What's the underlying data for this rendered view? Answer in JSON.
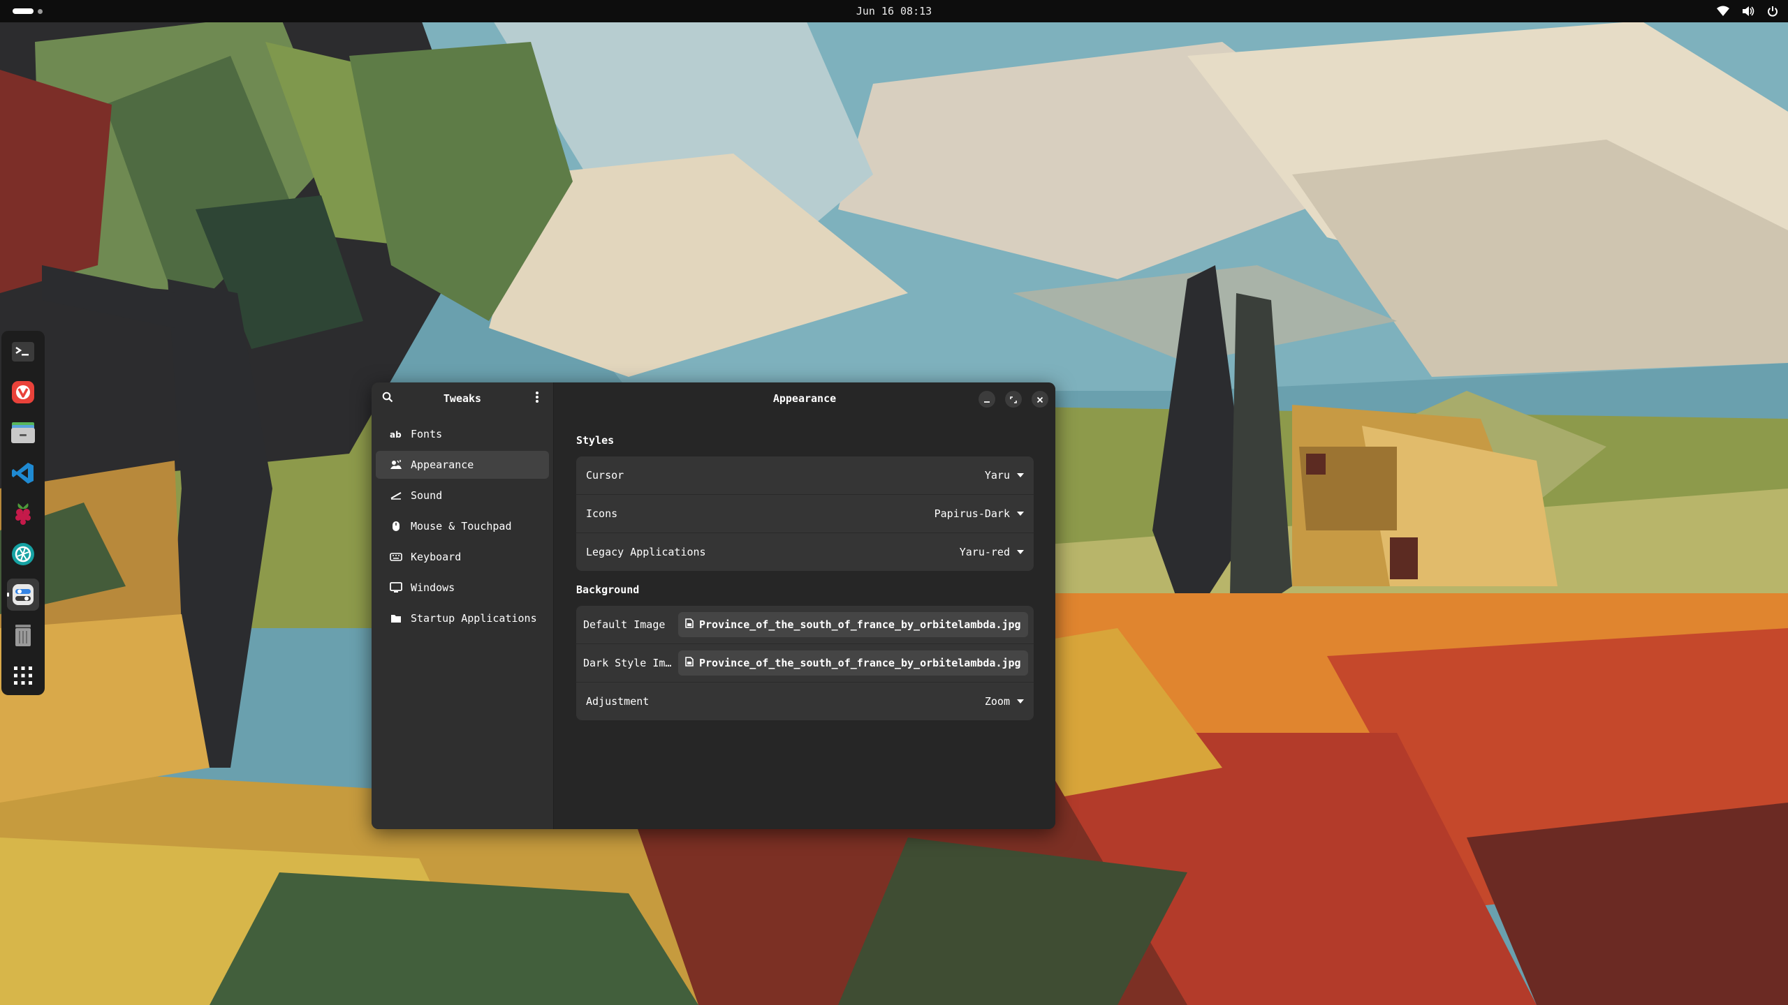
{
  "topbar": {
    "clock": "Jun 16 08:13",
    "tray_icons": [
      "wifi-icon",
      "volume-icon",
      "power-icon"
    ]
  },
  "dock": {
    "apps": [
      "terminal",
      "vivaldi-browser",
      "files",
      "vs-code",
      "raspberry-pi-imager",
      "aperture-app",
      "tweaks",
      "trash",
      "show-apps"
    ],
    "active": "tweaks"
  },
  "tweaks_window": {
    "sidebar_title": "Tweaks",
    "sidebar_items": [
      {
        "label": "Fonts",
        "icon": "font-ab-icon"
      },
      {
        "label": "Appearance",
        "icon": "appearance-icon",
        "selected": true
      },
      {
        "label": "Sound",
        "icon": "sound-icon"
      },
      {
        "label": "Mouse & Touchpad",
        "icon": "mouse-icon"
      },
      {
        "label": "Keyboard",
        "icon": "keyboard-icon"
      },
      {
        "label": "Windows",
        "icon": "windows-icon"
      },
      {
        "label": "Startup Applications",
        "icon": "folder-icon"
      }
    ],
    "content_title": "Appearance",
    "styles": {
      "title": "Styles",
      "cursor": {
        "label": "Cursor",
        "value": "Yaru"
      },
      "icons": {
        "label": "Icons",
        "value": "Papirus-Dark"
      },
      "legacy": {
        "label": "Legacy Applications",
        "value": "Yaru-red"
      }
    },
    "background": {
      "title": "Background",
      "default_image": {
        "label": "Default Image",
        "value": "Province_of_the_south_of_france_by_orbitelambda.jpg"
      },
      "dark_image": {
        "label": "Dark Style Im…",
        "value": "Province_of_the_south_of_france_by_orbitelambda.jpg"
      },
      "adjustment": {
        "label": "Adjustment",
        "value": "Zoom"
      }
    }
  },
  "colors": {
    "accent_red": "#e9423a",
    "vscode_blue": "#1f8ad2",
    "window_bg": "#2b2b2b"
  }
}
